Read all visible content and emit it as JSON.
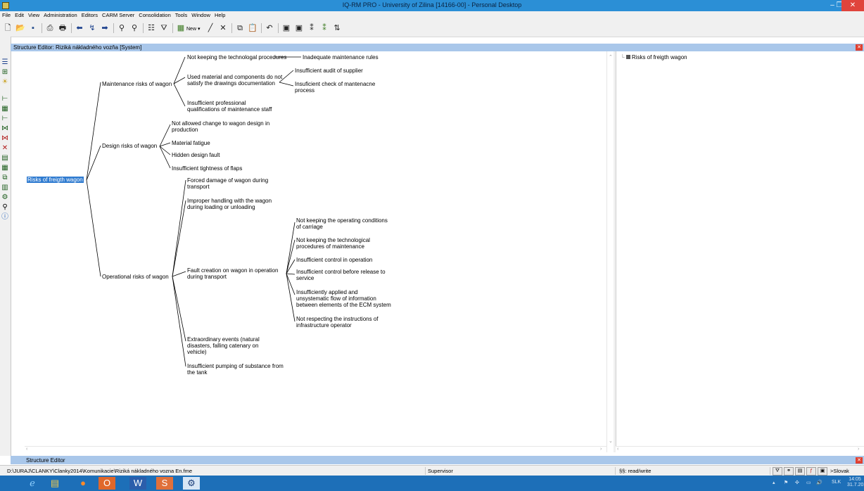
{
  "window": {
    "title": "IQ-RM PRO - University of Zilina [14166-00] - Personal Desktop",
    "minimize_glyph": "–",
    "restore_glyph": "❐",
    "close_glyph": "✕"
  },
  "menu": [
    "File",
    "Edit",
    "View",
    "Administration",
    "Editors",
    "CARM Server",
    "Consolidation",
    "Tools",
    "Window",
    "Help"
  ],
  "toolbar": {
    "new_label": "New",
    "icons": [
      "new-doc-icon",
      "open-folder-icon",
      "save-icon",
      "print-preview-icon",
      "print-icon",
      "back-icon",
      "jump-icon",
      "forward-icon",
      "find-icon",
      "find-next-icon",
      "properties-icon",
      "filter-icon",
      "new-item-icon",
      "edit-icon",
      "delete-icon",
      "copy-icon",
      "paste-icon",
      "undo-icon",
      "insert-above-icon",
      "insert-below-icon",
      "add-child-icon",
      "add-sibling-icon",
      "sort-icon"
    ]
  },
  "editor": {
    "title": "Structure Editor: Riziká nákladného vozňa [System]",
    "close_glyph": "✕"
  },
  "tree": {
    "root": "Risks of freigth wagon",
    "maintenance": {
      "label": "Maintenance risks of wagon",
      "c1": "Not keeping the technologal procedures",
      "c1a": "Inadequate maintenance rules",
      "c2_l1": "Used material and components do not",
      "c2_l2": "satisfy the drawings documentation",
      "c2a": "Insufficient audit of supplier",
      "c2b_l1": "Insuficient check of mantenacne",
      "c2b_l2": "process",
      "c3_l1": "Insufficient professional",
      "c3_l2": "qualifications of maintenance staff"
    },
    "design": {
      "label": "Design risks of wagon",
      "c1_l1": "Not allowed change to wagon design in",
      "c1_l2": "production",
      "c2": "Material fatigue",
      "c3": "Hidden design fault",
      "c4": "Insufficient tightness of flaps"
    },
    "operational": {
      "label": "Operational risks of wagon",
      "c1_l1": "Forced damage of wagon during",
      "c1_l2": "transport",
      "c2_l1": "Improper handling with the wagon",
      "c2_l2": "during loading or unloading",
      "c3_l1": "Fault creation on wagon in operation",
      "c3_l2": "during transport",
      "c3a_l1": "Not keeping the operating conditions",
      "c3a_l2": "of carriage",
      "c3b_l1": "Not keeping the technological",
      "c3b_l2": "procedures of maintenance",
      "c3c": "Insufficient control in operation",
      "c3d_l1": "Insufficient control before release to",
      "c3d_l2": "service",
      "c3e_l1": "Insufficiently applied and",
      "c3e_l2": "unsystematic flow of information",
      "c3e_l3": "between elements of the ECM system",
      "c3f_l1": "Not respecting the instructions of",
      "c3f_l2": "infrastructure operator",
      "c4_l1": "Extraordinary events (natural",
      "c4_l2": "disasters, falling catenary on",
      "c4_l3": "vehicle)",
      "c5_l1": "Insufficient pumping of substance from",
      "c5_l2": "the tank"
    }
  },
  "right_panel": {
    "item": "Risks of freigth wagon"
  },
  "footer_panel": {
    "title": "Structure Editor"
  },
  "status": {
    "path": "D:\\JURAJ\\CLANKY\\Clanky2014\\Komunikacie\\Riziká nákladného vozna En.fme",
    "user": "Supervisor",
    "mode": "§§: read/write",
    "lang": ">Slovak"
  },
  "taskbar": {
    "lang": "SLK",
    "time": "14:05",
    "date": "31.7.2014"
  },
  "colors": {
    "titlebar": "#2b8fd6",
    "pane_header": "#a9c7ea",
    "selection": "#2f7bd0",
    "taskbar": "#1d6fb8",
    "close": "#e0443c"
  }
}
